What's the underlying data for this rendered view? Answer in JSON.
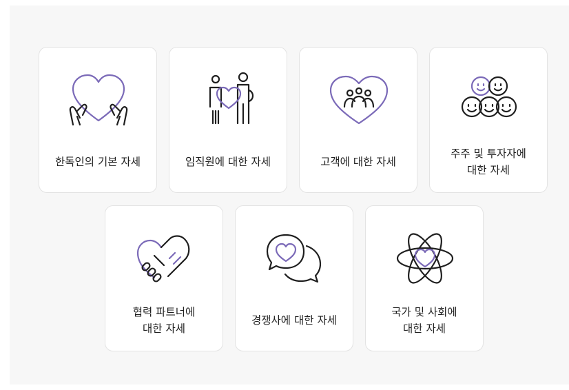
{
  "cards": [
    {
      "label": "한독인의 기본 자세",
      "icon": "heart-hands-icon"
    },
    {
      "label": "임직원에 대한 자세",
      "icon": "people-heart-icon"
    },
    {
      "label": "고객에 대한 자세",
      "icon": "heart-group-icon"
    },
    {
      "label": "주주 및 투자자에\n대한 자세",
      "icon": "smiley-faces-icon"
    },
    {
      "label": "협력 파트너에\n대한 자세",
      "icon": "handshake-heart-icon"
    },
    {
      "label": "경쟁사에 대한 자세",
      "icon": "speech-bubbles-heart-icon"
    },
    {
      "label": "국가 및 사회에\n대한 자세",
      "icon": "atom-heart-icon"
    }
  ],
  "colors": {
    "accent": "#7b6ab8",
    "line": "#1f1f1f",
    "card_border": "#e3e3e3",
    "background": "#f7f7f7"
  }
}
